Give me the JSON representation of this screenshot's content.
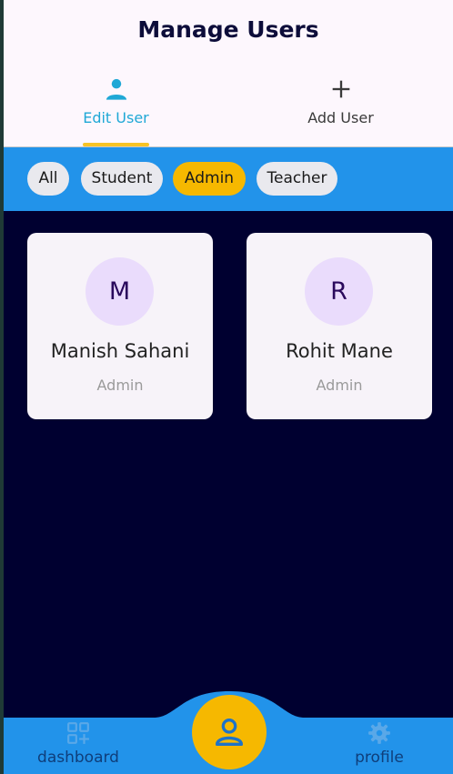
{
  "header": {
    "title": "Manage Users",
    "tabs": [
      {
        "label": "Edit User",
        "icon": "person-icon",
        "active": true
      },
      {
        "label": "Add User",
        "icon": "plus-icon",
        "active": false
      }
    ]
  },
  "filters": {
    "chips": [
      {
        "label": "All",
        "active": false
      },
      {
        "label": "Student",
        "active": false
      },
      {
        "label": "Admin",
        "active": true
      },
      {
        "label": "Teacher",
        "active": false
      }
    ]
  },
  "users": [
    {
      "initial": "M",
      "name": "Manish Sahani",
      "role": "Admin"
    },
    {
      "initial": "R",
      "name": "Rohit Mane",
      "role": "Admin"
    }
  ],
  "bottom_nav": {
    "items": [
      {
        "label": "dashboard",
        "icon": "dashboard-icon"
      },
      {
        "label": "profile",
        "icon": "gear-icon"
      }
    ],
    "center_icon": "user-icon"
  },
  "colors": {
    "header_bg": "#fdf7fd",
    "accent_blue": "#2293ea",
    "accent_yellow": "#f6b800",
    "tab_active": "#1fa8d6",
    "content_bg": "#000030",
    "card_bg": "#f7f3f9",
    "avatar_bg": "#eadcfc"
  }
}
